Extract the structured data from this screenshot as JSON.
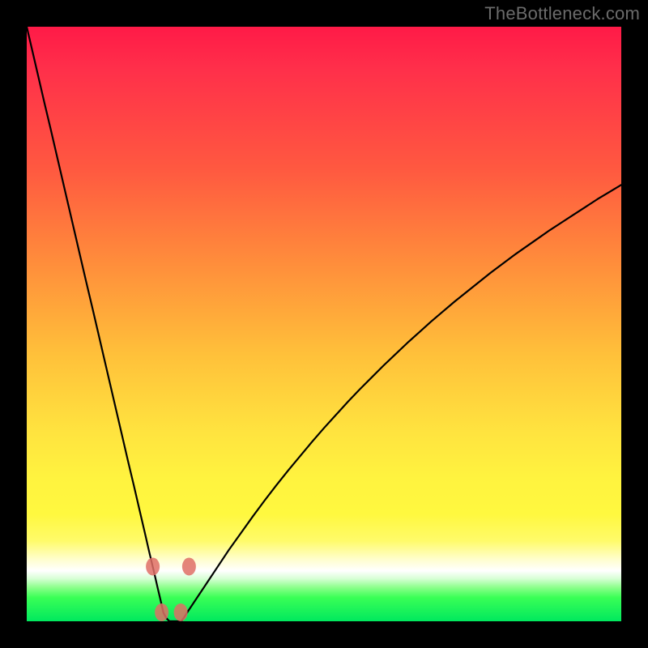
{
  "watermark": "TheBottleneck.com",
  "colors": {
    "frame": "#000000",
    "watermark": "#6b6b6b",
    "curve": "#000000",
    "dot": "#df6e66",
    "gradient_stops": [
      {
        "pos": 0,
        "hex": "#ff1a47"
      },
      {
        "pos": 0.24,
        "hex": "#ff5940"
      },
      {
        "pos": 0.55,
        "hex": "#ffc03a"
      },
      {
        "pos": 0.76,
        "hex": "#fff33f"
      },
      {
        "pos": 0.915,
        "hex": "#ffffff"
      },
      {
        "pos": 1.0,
        "hex": "#00e85e"
      }
    ]
  },
  "chart_data": {
    "type": "line",
    "title": "",
    "xlabel": "",
    "ylabel": "",
    "xlim": [
      0,
      100
    ],
    "ylim": [
      0,
      100
    ],
    "grid": false,
    "legend": false,
    "x": [
      0,
      1,
      2,
      3,
      4,
      5,
      6,
      7,
      8,
      9,
      10,
      11,
      12,
      13,
      14,
      15,
      16,
      17,
      18,
      19,
      20,
      20.5,
      21,
      21.5,
      22,
      22.5,
      23,
      23.5,
      24,
      24.5,
      25,
      25.5,
      26,
      26.5,
      27,
      28,
      29,
      30,
      32,
      34,
      36,
      38,
      40,
      42,
      44,
      46,
      48,
      50,
      52,
      54,
      56,
      58,
      60,
      62,
      64,
      66,
      68,
      70,
      72,
      74,
      76,
      78,
      80,
      82,
      84,
      86,
      88,
      90,
      92,
      94,
      96,
      98,
      100
    ],
    "y": [
      100,
      95.7,
      91.4,
      87.1,
      82.9,
      78.6,
      74.3,
      70,
      65.7,
      61.4,
      57.1,
      52.9,
      48.6,
      44.3,
      40,
      35.7,
      31.4,
      27.1,
      22.9,
      18.6,
      14.3,
      12.1,
      10,
      7.9,
      5.7,
      3.6,
      1.4,
      0.5,
      0,
      0,
      0,
      0,
      0,
      0.7,
      1.5,
      3,
      4.5,
      6,
      9,
      12,
      14.8,
      17.6,
      20.3,
      22.9,
      25.4,
      27.8,
      30.2,
      32.5,
      34.7,
      36.9,
      39,
      41,
      43,
      44.9,
      46.8,
      48.6,
      50.4,
      52.1,
      53.8,
      55.4,
      57,
      58.6,
      60.1,
      61.6,
      63,
      64.4,
      65.8,
      67.1,
      68.4,
      69.7,
      71,
      72.2,
      73.4
    ],
    "markers": [
      {
        "x": 21.2,
        "y": 9.2
      },
      {
        "x": 22.7,
        "y": 1.5
      },
      {
        "x": 25.9,
        "y": 1.5
      },
      {
        "x": 27.3,
        "y": 9.2
      }
    ],
    "note": "y is percent height from bottom of plotting area; curve is a single continuous line"
  }
}
